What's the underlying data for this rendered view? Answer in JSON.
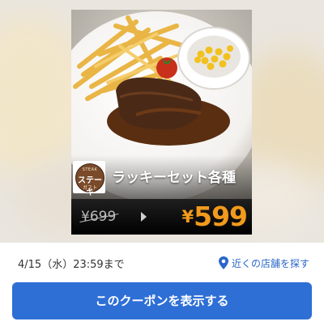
{
  "coupon": {
    "brand": {
      "top": "STEAK",
      "name": "ステーキ",
      "sub": "ガスト"
    },
    "title": "ラッキーセット各種",
    "old_price": "¥699",
    "new_price_symbol": "¥",
    "new_price": "599",
    "colors": {
      "price_accent": "#f29a1d",
      "price_bar": "#000000"
    }
  },
  "info": {
    "deadline": "4/15（水）23:59まで",
    "store_link_label": "近くの店舗を探す",
    "store_link_icon": "map-pin-icon"
  },
  "cta": {
    "label": "このクーポンを表示する",
    "color": "#2e6fd6"
  }
}
